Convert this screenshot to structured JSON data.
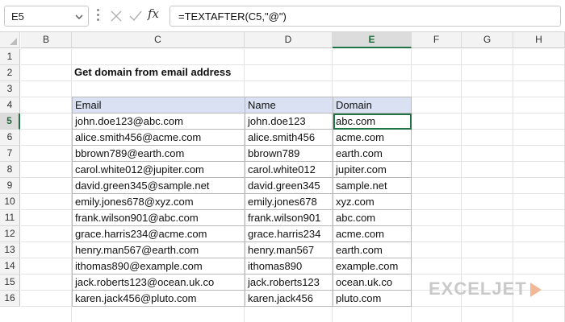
{
  "name_box": {
    "value": "E5"
  },
  "formula_bar": {
    "fx_label": "fx",
    "formula": "=TEXTAFTER(C5,\"@\")"
  },
  "columns": [
    "B",
    "C",
    "D",
    "E",
    "F",
    "G",
    "H"
  ],
  "rows": [
    "1",
    "2",
    "3",
    "4",
    "5",
    "6",
    "7",
    "8",
    "9",
    "10",
    "11",
    "12",
    "13",
    "14",
    "15",
    "16"
  ],
  "selected_cell": {
    "column": "E",
    "row": "5"
  },
  "sheet": {
    "title": "Get domain from email address",
    "headers": {
      "email": "Email",
      "name": "Name",
      "domain": "Domain"
    },
    "data": [
      {
        "email": "john.doe123@abc.com",
        "name": "john.doe123",
        "domain": "abc.com"
      },
      {
        "email": "alice.smith456@acme.com",
        "name": "alice.smith456",
        "domain": "acme.com"
      },
      {
        "email": "bbrown789@earth.com",
        "name": "bbrown789",
        "domain": "earth.com"
      },
      {
        "email": "carol.white012@jupiter.com",
        "name": "carol.white012",
        "domain": "jupiter.com"
      },
      {
        "email": "david.green345@sample.net",
        "name": "david.green345",
        "domain": "sample.net"
      },
      {
        "email": "emily.jones678@xyz.com",
        "name": "emily.jones678",
        "domain": "xyz.com"
      },
      {
        "email": "frank.wilson901@abc.com",
        "name": "frank.wilson901",
        "domain": "abc.com"
      },
      {
        "email": "grace.harris234@acme.com",
        "name": "grace.harris234",
        "domain": "acme.com"
      },
      {
        "email": "henry.man567@earth.com",
        "name": "henry.man567",
        "domain": "earth.com"
      },
      {
        "email": "ithomas890@example.com",
        "name": "ithomas890",
        "domain": "example.com"
      },
      {
        "email": "jack.roberts123@ocean.uk.co",
        "name": "jack.roberts123",
        "domain": "ocean.uk.co"
      },
      {
        "email": "karen.jack456@pluto.com",
        "name": "karen.jack456",
        "domain": "pluto.com"
      }
    ]
  },
  "logo": {
    "text": "EXCELJET"
  },
  "colors": {
    "accent": "#217346",
    "header_fill": "#d9e1f2"
  },
  "icons": {
    "cancel": "x-icon",
    "enter": "check-icon",
    "function": "fx-icon"
  }
}
